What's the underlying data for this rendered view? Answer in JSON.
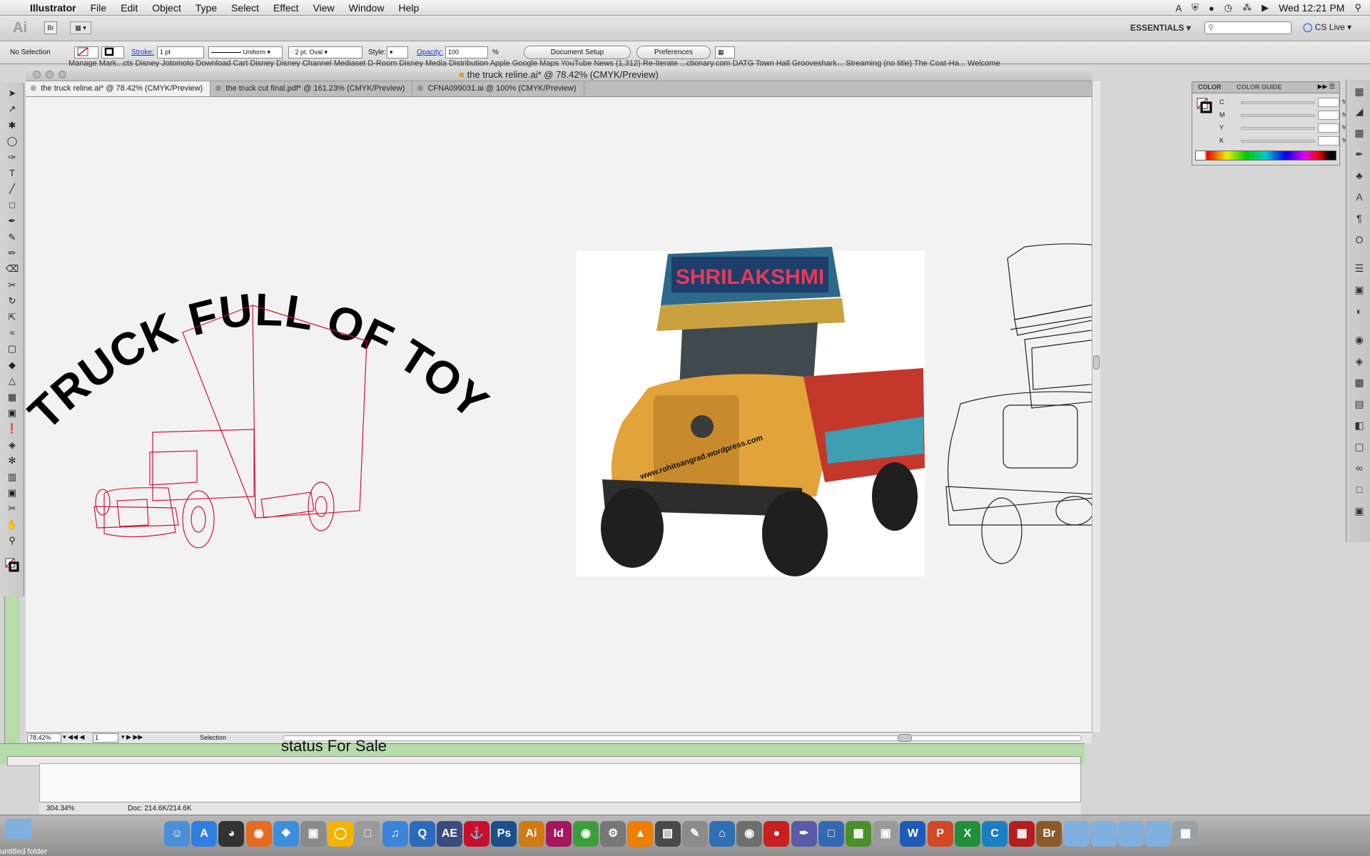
{
  "menubar": {
    "app_name": "Illustrator",
    "items": [
      "File",
      "Edit",
      "Object",
      "Type",
      "Select",
      "Effect",
      "View",
      "Window",
      "Help"
    ],
    "clock": "Wed 12:21 PM"
  },
  "appbar": {
    "logo": "Ai",
    "bridge": "Br",
    "workspace": "ESSENTIALS",
    "cs_live": "CS Live"
  },
  "control_bar": {
    "selection": "No Selection",
    "stroke_label": "Stroke:",
    "stroke_value": "1 pt",
    "profile": "Uniform",
    "brush": "2 pt. Oval",
    "style_label": "Style:",
    "opacity_label": "Opacity:",
    "opacity_value": "100",
    "percent": "%",
    "document_setup": "Document Setup",
    "preferences": "Preferences"
  },
  "bookmarks": "Manage Mark...cts Disney   Jotomoto   Download Cart Disney   Disney Channel Mediaset   D-Room   Disney Media Distribution   Apple   Google Maps   YouTube   News (1,312)   Re-Iterate ...ctionary.com   DATG Town Hall   Grooveshark... Streaming   (no title)   The Coat-Ha...   Welcome",
  "document": {
    "title": "the truck reline.ai* @ 78.42% (CMYK/Preview)",
    "tabs": [
      {
        "label": "the truck reline.ai* @ 78.42% (CMYK/Preview)",
        "active": true
      },
      {
        "label": "the truck cut final.pdf* @ 161.23% (CMYK/Preview)",
        "active": false
      },
      {
        "label": "CFNA099031.ai @ 100% (CMYK/Preview)",
        "active": false
      }
    ]
  },
  "artwork": {
    "headline": "TRUCK FULL OF TOYS!",
    "truck_sign": "SHRILAKSHMI",
    "watermark": "www.rohitsangrad.wordpress.com"
  },
  "status": {
    "zoom": "78.42%",
    "page": "1",
    "tool": "Selection"
  },
  "background": {
    "window_text": "status For Sale",
    "zoom2": "304.34%",
    "doc_size": "Doc: 214.6K/214.6K",
    "desktop_label": "untitled folder"
  },
  "color_panel": {
    "tab_color": "COLOR",
    "tab_guide": "COLOR GUIDE",
    "channels": [
      "C",
      "M",
      "Y",
      "K"
    ],
    "percent": "%"
  },
  "tools": [
    "selection-icon",
    "direct-selection-icon",
    "magic-wand-icon",
    "lasso-icon",
    "pen-icon",
    "type-icon",
    "line-icon",
    "rectangle-icon",
    "paintbrush-icon",
    "pencil-icon",
    "blob-brush-icon",
    "eraser-icon",
    "scissors-icon",
    "rotate-icon",
    "scale-icon",
    "warp-icon",
    "free-transform-icon",
    "shape-builder-icon",
    "perspective-icon",
    "mesh-icon",
    "gradient-icon",
    "eyedropper-icon",
    "blend-icon",
    "symbol-sprayer-icon",
    "column-graph-icon",
    "artboard-icon",
    "slice-icon",
    "hand-icon",
    "zoom-icon"
  ],
  "colors": {
    "accent_red": "#d0143c",
    "canvas_bg": "#f2f2f2",
    "green_window": "#b6dcaa"
  }
}
